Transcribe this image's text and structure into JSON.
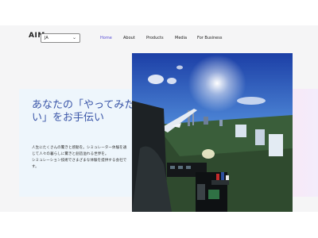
{
  "header": {
    "logo": "AIM",
    "language": "JA",
    "nav": [
      "Home",
      "About",
      "Products",
      "Media",
      "For Business"
    ]
  },
  "hero": {
    "title": "あなたの「やってみたい」をお手伝い",
    "paragraph1": "人生にたくさんの驚きと感動を。シミュレーター体験を通じて人々の暮らしに驚きと創造溢れる世界を。",
    "paragraph2": "シミュレーション技術でさまざまな体験を提供する会社です。"
  },
  "colors": {
    "accent": "#5b4fd6",
    "title": "#3b56a8"
  }
}
